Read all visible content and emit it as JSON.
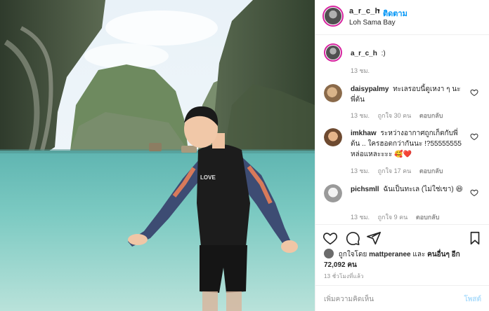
{
  "post": {
    "username": "a_r_c_h",
    "separator": "•",
    "follow_label": "ติดตาม",
    "location": "Loh Sama Bay",
    "more_icon": "more-horizontal-icon",
    "photo_description_icon": "photo"
  },
  "caption": {
    "username": "a_r_c_h",
    "text": ":)",
    "time": "13 ชม."
  },
  "comments": [
    {
      "username": "daisypalmy",
      "text": "ทะเลรอบนี้ดูเหงา ๆ นะพี่ต้น",
      "time": "13 ชม.",
      "likes": "ถูกใจ 30 คน",
      "reply": "ตอบกลับ"
    },
    {
      "username": "imkhaw",
      "text": "ระหว่างอากาศถูกเก็ตกับพี่ต้น .. ใครฮอตกว่ากันนะ !?55555555 หล่อแหละะะะ 🥰❤️",
      "time": "13 ชม.",
      "likes": "ถูกใจ 17 คน",
      "reply": "ตอบกลับ"
    },
    {
      "username": "pichsmll",
      "text": "ฉันเป็นทะเล (ไม่ใช่เขา) 😆",
      "time": "13 ชม.",
      "likes": "ถูกใจ 9 คน",
      "reply": "ตอบกลับ"
    }
  ],
  "likes": {
    "prefix": "ถูกใจโดย",
    "user": "mattperanee",
    "conj": "และ",
    "others": "คนอื่นๆ อีก 72,092 คน"
  },
  "time_ago": "13 ชั่วโมงที่แล้ว",
  "add_comment": {
    "placeholder": "เพิ่มความคิดเห็น",
    "post_label": "โพสต์"
  },
  "colors": {
    "link_blue": "#0095f6",
    "muted": "#8e8e8e",
    "story_ring": "#d6249f"
  }
}
